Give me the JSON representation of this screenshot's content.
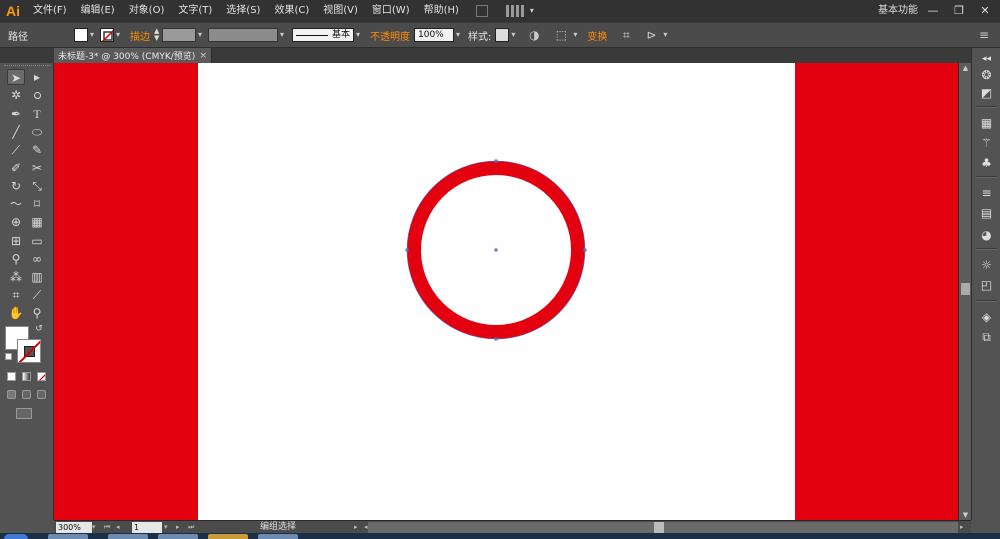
{
  "app": {
    "logo": "Ai",
    "menus": [
      "文件(F)",
      "编辑(E)",
      "对象(O)",
      "文字(T)",
      "选择(S)",
      "效果(C)",
      "视图(V)",
      "窗口(W)",
      "帮助(H)"
    ],
    "workspace": "基本功能",
    "window_controls": {
      "minimize": "—",
      "restore": "❐",
      "close": "✕"
    }
  },
  "control_bar": {
    "object_type": "路径",
    "stroke_link": "描边",
    "stroke_style": "基本",
    "opacity_link": "不透明度",
    "opacity_value": "100%",
    "style_label": "样式:",
    "transform_link": "变换"
  },
  "document": {
    "tab_title": "未标题-3* @ 300% (CMYK/预览)",
    "close_icon": "×"
  },
  "status": {
    "zoom": "300%",
    "page": "1",
    "tool_status": "编组选择"
  },
  "colors": {
    "background_red": "#e3000f",
    "artboard": "#ffffff",
    "ui_dark": "#535353",
    "accent_orange": "#ff8c00",
    "anchor_blue": "#4a7bd0"
  },
  "icons": {
    "selection": "selection-arrow-icon",
    "direct_selection": "direct-selection-icon",
    "magic_wand": "magic-wand-icon",
    "lasso": "lasso-icon",
    "pen": "pen-icon",
    "type": "type-icon",
    "line": "line-segment-icon",
    "ellipse": "ellipse-icon",
    "paintbrush": "paintbrush-icon",
    "pencil": "pencil-icon",
    "blob_brush": "blob-brush-icon",
    "scissors": "scissors-icon",
    "rotate": "rotate-icon",
    "scale": "scale-icon",
    "warp": "warp-icon",
    "free_transform": "free-transform-icon",
    "shape_builder": "shape-builder-icon",
    "perspective": "perspective-grid-icon",
    "mesh": "mesh-icon",
    "gradient": "gradient-icon",
    "eyedropper": "eyedropper-icon",
    "blend": "blend-icon",
    "symbol_sprayer": "symbol-sprayer-icon",
    "column_graph": "column-graph-icon",
    "artboard": "artboard-icon",
    "slice": "slice-icon",
    "hand": "hand-icon",
    "zoom": "zoom-icon"
  }
}
